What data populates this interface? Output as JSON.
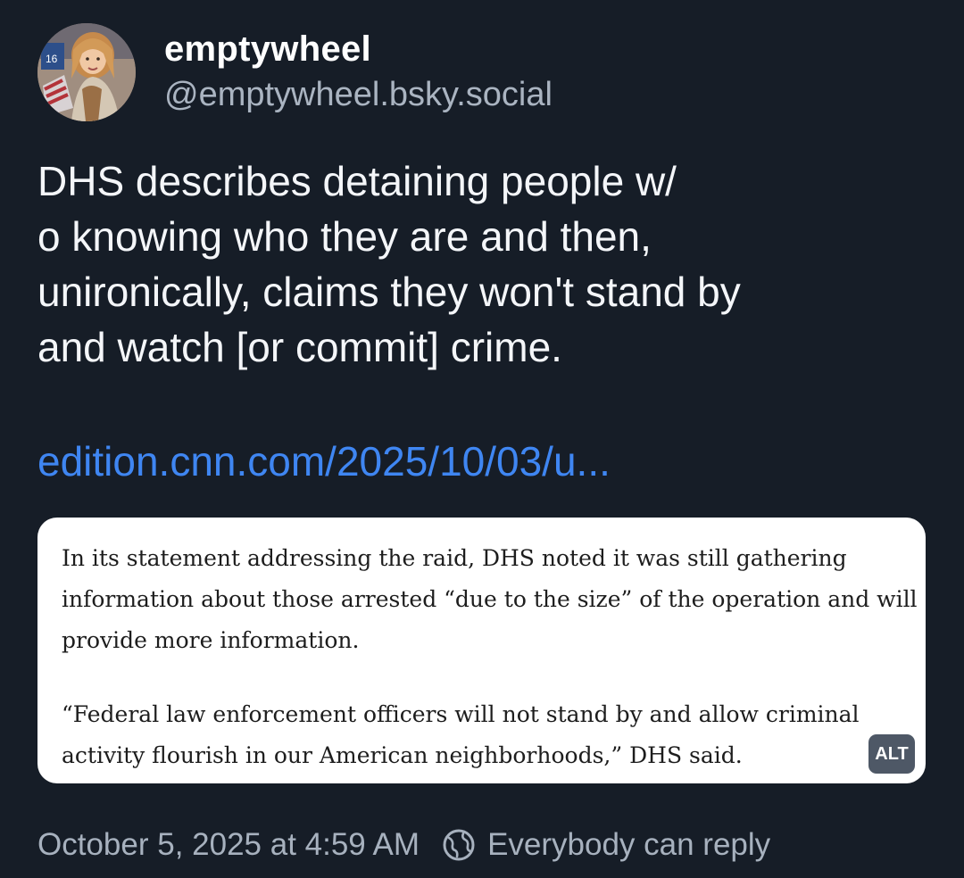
{
  "author": {
    "display_name": "emptywheel",
    "handle": "@emptywheel.bsky.social",
    "avatar_icon": "user-avatar-photo"
  },
  "post": {
    "text_lines": [
      "DHS describes detaining people w/",
      "o knowing who they are and then,",
      "unironically, claims they won't stand by",
      "and watch [or commit] crime."
    ],
    "link_text": "edition.cnn.com/2025/10/03/u..."
  },
  "embed_image": {
    "paragraph1_lines": [
      "In its statement addressing the raid, DHS noted it was still gathering",
      "information about those arrested “due to the size” of the operation and will",
      "provide more information."
    ],
    "paragraph2_lines": [
      "“Federal law enforcement officers will not stand by and allow criminal",
      "activity flourish in our American neighborhoods,” DHS said."
    ],
    "alt_label": "ALT"
  },
  "footer": {
    "timestamp": "October 5, 2025 at 4:59 AM",
    "reply_setting": "Everybody can reply",
    "reply_icon": "globe-icon"
  },
  "colors": {
    "background": "#161d27",
    "link": "#3f86f2",
    "muted_text": "#a7b1be"
  }
}
